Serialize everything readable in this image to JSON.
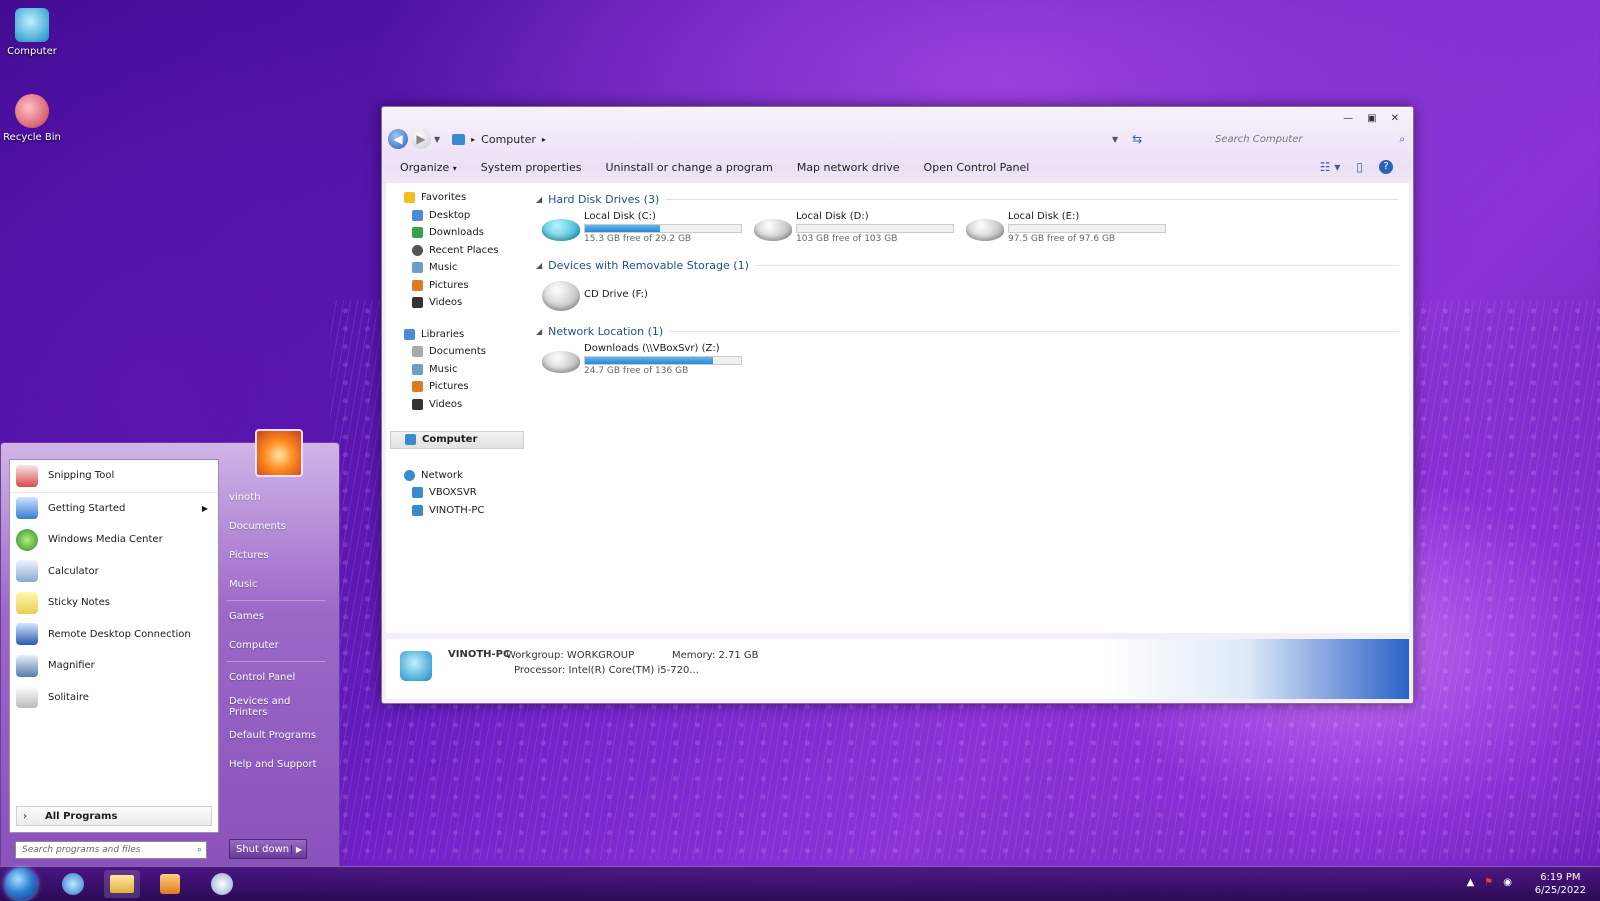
{
  "desktop": {
    "icons": [
      {
        "label": "Computer"
      },
      {
        "label": "Recycle Bin"
      }
    ]
  },
  "explorer": {
    "address": {
      "root": "Computer"
    },
    "search_placeholder": "Search Computer",
    "toolbar": {
      "organize": "Organize",
      "system_properties": "System properties",
      "uninstall": "Uninstall or change a program",
      "map_drive": "Map network drive",
      "control_panel": "Open Control Panel"
    },
    "nav": {
      "favorites": {
        "label": "Favorites",
        "items": [
          "Desktop",
          "Downloads",
          "Recent Places",
          "Music",
          "Pictures",
          "Videos"
        ]
      },
      "libraries": {
        "label": "Libraries",
        "items": [
          "Documents",
          "Music",
          "Pictures",
          "Videos"
        ]
      },
      "computer": "Computer",
      "network": {
        "label": "Network",
        "items": [
          "VBOXSVR",
          "VINOTH-PC"
        ]
      }
    },
    "groups": {
      "hdd": "Hard Disk Drives (3)",
      "removable": "Devices with Removable Storage (1)",
      "network": "Network Location (1)"
    },
    "drives": {
      "c": {
        "name": "Local Disk (C:)",
        "free": "15.3 GB free of 29.2 GB",
        "used_fraction": 0.48
      },
      "d": {
        "name": "Local Disk (D:)",
        "free": "103 GB free of 103 GB",
        "used_fraction": 0.0
      },
      "e": {
        "name": "Local Disk (E:)",
        "free": "97.5 GB free of 97.6 GB",
        "used_fraction": 0.0
      },
      "f": {
        "name": "CD Drive (F:)"
      },
      "z": {
        "name": "Downloads (\\\\VBoxSvr) (Z:)",
        "free": "24.7 GB free of 136 GB",
        "used_fraction": 0.82
      }
    },
    "details": {
      "pc_name": "VINOTH-PC",
      "workgroup": "Workgroup: WORKGROUP",
      "memory": "Memory: 2.71 GB",
      "processor": "Processor: Intel(R) Core(TM) i5-720..."
    }
  },
  "start_menu": {
    "programs": [
      "Snipping Tool",
      "Getting Started",
      "Windows Media Center",
      "Calculator",
      "Sticky Notes",
      "Remote Desktop Connection",
      "Magnifier",
      "Solitaire"
    ],
    "all_programs": "All Programs",
    "search_placeholder": "Search programs and files",
    "links": [
      "vinoth",
      "Documents",
      "Pictures",
      "Music",
      "Games",
      "Computer",
      "Control Panel",
      "Devices and Printers",
      "Default Programs",
      "Help and Support"
    ],
    "shutdown": "Shut down"
  },
  "taskbar": {
    "time": "6:19 PM",
    "date": "6/25/2022"
  },
  "colors": {
    "accent": "#1f4e96",
    "drive_bar": "#2a88d0",
    "start_bg": "#9b68c8"
  }
}
